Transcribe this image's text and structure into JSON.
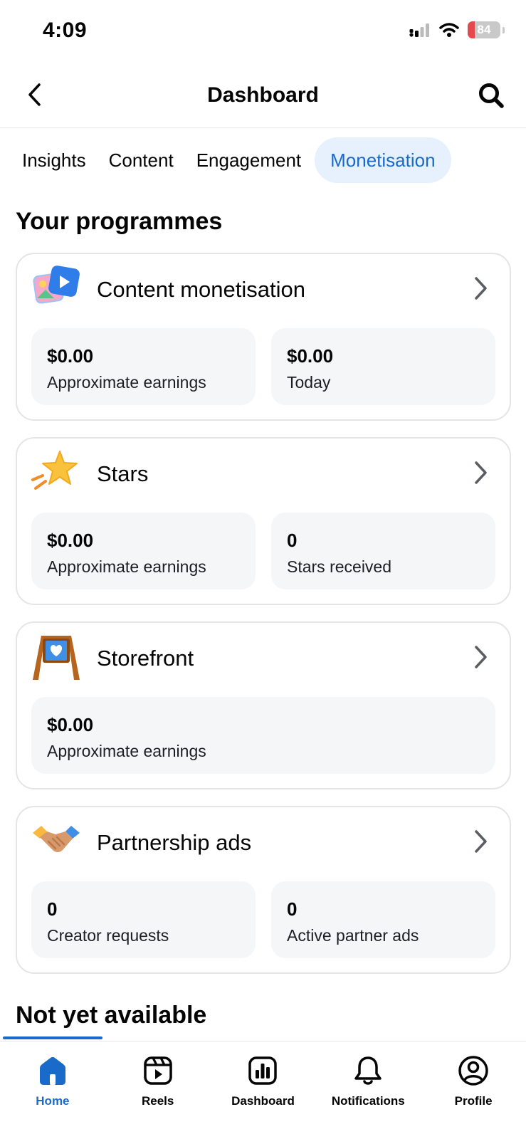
{
  "status_bar": {
    "time": "4:09",
    "battery": "84"
  },
  "header": {
    "title": "Dashboard"
  },
  "tabs": [
    {
      "label": "Insights",
      "active": false
    },
    {
      "label": "Content",
      "active": false
    },
    {
      "label": "Engagement",
      "active": false
    },
    {
      "label": "Monetisation",
      "active": true
    }
  ],
  "section_title": "Your programmes",
  "programmes": [
    {
      "name": "Content monetisation",
      "icon": "video-gallery-icon",
      "stats": [
        {
          "value": "$0.00",
          "label": "Approximate earnings"
        },
        {
          "value": "$0.00",
          "label": "Today"
        }
      ]
    },
    {
      "name": "Stars",
      "icon": "shooting-star-icon",
      "stats": [
        {
          "value": "$0.00",
          "label": "Approximate earnings"
        },
        {
          "value": "0",
          "label": "Stars received"
        }
      ]
    },
    {
      "name": "Storefront",
      "icon": "storefront-sign-icon",
      "stats": [
        {
          "value": "$0.00",
          "label": "Approximate earnings"
        }
      ]
    },
    {
      "name": "Partnership ads",
      "icon": "handshake-icon",
      "stats": [
        {
          "value": "0",
          "label": "Creator requests"
        },
        {
          "value": "0",
          "label": "Active partner ads"
        }
      ]
    }
  ],
  "not_yet_title": "Not yet available",
  "bottom_nav": [
    {
      "label": "Home",
      "icon": "home-icon",
      "active": true
    },
    {
      "label": "Reels",
      "icon": "reels-icon",
      "active": false
    },
    {
      "label": "Dashboard",
      "icon": "dashboard-icon",
      "active": false
    },
    {
      "label": "Notifications",
      "icon": "bell-icon",
      "active": false
    },
    {
      "label": "Profile",
      "icon": "profile-icon",
      "active": false
    }
  ],
  "colors": {
    "accent": "#1a6bc9",
    "active_tab_bg": "#e7f1fd",
    "stat_bg": "#f5f6f8",
    "card_border": "#e3e5e8"
  }
}
